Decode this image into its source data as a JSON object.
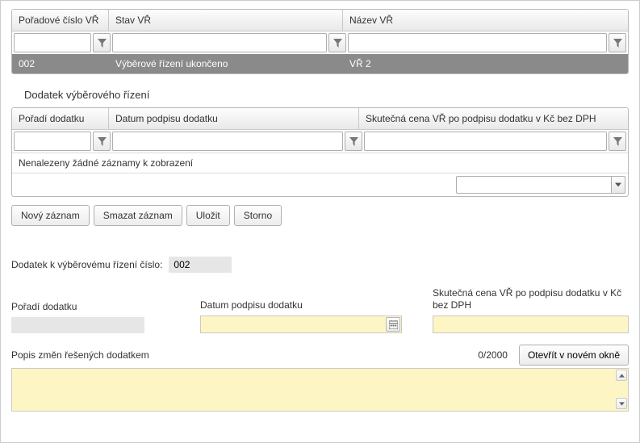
{
  "grid1": {
    "headers": {
      "col1": "Pořadové číslo VŘ",
      "col2": "Stav VŘ",
      "col3": "Název VŘ"
    },
    "row": {
      "c1": "002",
      "c2": "Výběrové řízení ukončeno",
      "c3": "VŘ 2"
    }
  },
  "section_title": "Dodatek výběrového řízení",
  "grid2": {
    "headers": {
      "col1": "Pořadí dodatku",
      "col2": "Datum podpisu dodatku",
      "col3": "Skutečná cena VŘ po podpisu dodatku v Kč bez DPH"
    },
    "empty_text": "Nenalezeny žádné záznamy k zobrazení"
  },
  "toolbar": {
    "new_label": "Nový záznam",
    "delete_label": "Smazat záznam",
    "save_label": "Uložit",
    "cancel_label": "Storno"
  },
  "form": {
    "linked_label": "Dodatek k výběrovému řízení číslo:",
    "linked_value": "002",
    "order_label": "Pořadí dodatku",
    "date_label": "Datum podpisu dodatku",
    "price_label": "Skutečná cena VŘ po podpisu dodatku v Kč bez DPH",
    "desc_label": "Popis změn řešených dodatkem",
    "char_count": "0/2000",
    "open_window_label": "Otevřít v novém okně"
  }
}
